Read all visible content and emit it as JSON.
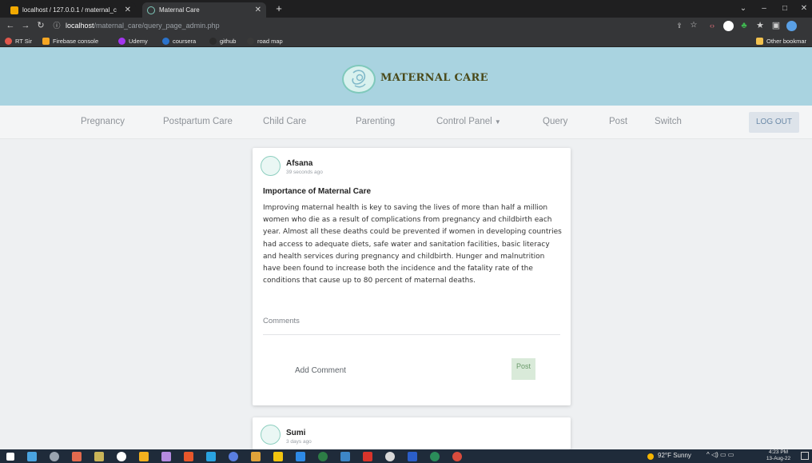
{
  "browser": {
    "tabs": [
      {
        "title": "localhost / 127.0.0.1 / maternal_c",
        "active": false
      },
      {
        "title": "Maternal Care",
        "active": true
      }
    ],
    "url_host": "localhost",
    "url_path": "/maternal_care/query_page_admin.php",
    "bookmarks": [
      "RT Sir",
      "Firebase console",
      "Udemy",
      "coursera",
      "github",
      "road map"
    ],
    "other_bookmarks": "Other bookmar"
  },
  "site": {
    "brand": "MATERNAL CARE",
    "nav": [
      "Pregnancy",
      "Postpartum Care",
      "Child Care",
      "Parenting",
      "Control Panel",
      "Query",
      "Post",
      "Switch"
    ],
    "logout": "LOG OUT"
  },
  "posts": [
    {
      "author": "Afsana",
      "time": "39 seconds ago",
      "title": "Importance of Maternal Care",
      "body": "Improving maternal health is key to saving the lives of more than half a million women who die as a result of complications from pregnancy and childbirth each year. Almost all these deaths could be prevented if women in developing countries had access to adequate diets, safe water and sanitation facilities, basic literacy and health services during pregnancy and childbirth. Hunger and malnutrition have been found to increase both the incidence and the fatality rate of the conditions that cause up to 80 percent of maternal deaths.",
      "comments_label": "Comments",
      "add_comment_placeholder": "Add Comment",
      "post_button": "Post"
    },
    {
      "author": "Sumi",
      "time": "3 days ago"
    }
  ],
  "taskbar": {
    "weather": "92°F Sunny",
    "time": "4:23 PM",
    "date": "13-Aug-22"
  },
  "colors": {
    "header_bg": "#a9d3e0",
    "nav_bg": "#f4f5f6",
    "brand_text": "#4a4a1a",
    "logout_bg": "#dde3ea",
    "post_btn_bg": "#d9ead9"
  }
}
